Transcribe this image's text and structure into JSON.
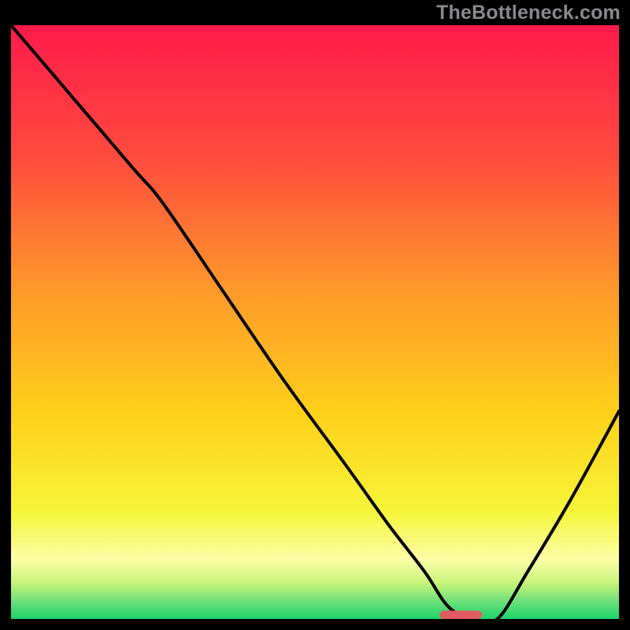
{
  "watermark": "TheBottleneck.com",
  "colors": {
    "frame": "#000000",
    "line": "#000000",
    "marker": "#e05a62",
    "gradient_stops": [
      {
        "offset": 0.0,
        "color": "#ff1a4b"
      },
      {
        "offset": 0.22,
        "color": "#ff4a3e"
      },
      {
        "offset": 0.45,
        "color": "#ff9a2a"
      },
      {
        "offset": 0.66,
        "color": "#ffd21a"
      },
      {
        "offset": 0.82,
        "color": "#f5f53a"
      },
      {
        "offset": 0.9,
        "color": "#fdffa8"
      },
      {
        "offset": 0.94,
        "color": "#c6f47a"
      },
      {
        "offset": 0.97,
        "color": "#6ee07a"
      },
      {
        "offset": 1.0,
        "color": "#1dd36b"
      }
    ]
  },
  "chart_data": {
    "type": "line",
    "title": "",
    "xlabel": "",
    "ylabel": "",
    "xlim": [
      0,
      100
    ],
    "ylim": [
      0,
      100
    ],
    "grid": false,
    "x": [
      0,
      10,
      20,
      25,
      35,
      45,
      55,
      62,
      68,
      72,
      76,
      80,
      85,
      92,
      100
    ],
    "values": [
      100,
      88,
      76,
      70,
      55,
      40,
      26,
      16,
      8,
      2,
      0,
      0,
      8,
      20,
      35
    ],
    "marker": {
      "x": 74,
      "y": 0,
      "width": 7,
      "height": 1.4
    }
  }
}
